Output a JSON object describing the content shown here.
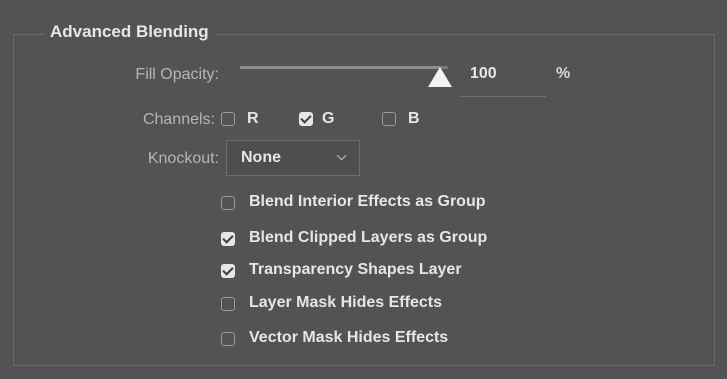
{
  "group": {
    "title": "Advanced Blending"
  },
  "fill_opacity": {
    "label": "Fill Opacity:",
    "value": "100",
    "unit": "%",
    "slider_fraction": 1.0
  },
  "channels": {
    "label": "Channels:",
    "items": [
      {
        "label": "R",
        "checked": false
      },
      {
        "label": "G",
        "checked": true
      },
      {
        "label": "B",
        "checked": false
      }
    ]
  },
  "knockout": {
    "label": "Knockout:",
    "selected": "None"
  },
  "options": [
    {
      "label": "Blend Interior Effects as Group",
      "checked": false
    },
    {
      "label": "Blend Clipped Layers as Group",
      "checked": true
    },
    {
      "label": "Transparency Shapes Layer",
      "checked": true
    },
    {
      "label": "Layer Mask Hides Effects",
      "checked": false
    },
    {
      "label": "Vector Mask Hides Effects",
      "checked": false
    }
  ],
  "colors": {
    "panel_bg": "#535353",
    "text_primary": "#e6e6e6",
    "text_label": "#b5b5b5"
  }
}
